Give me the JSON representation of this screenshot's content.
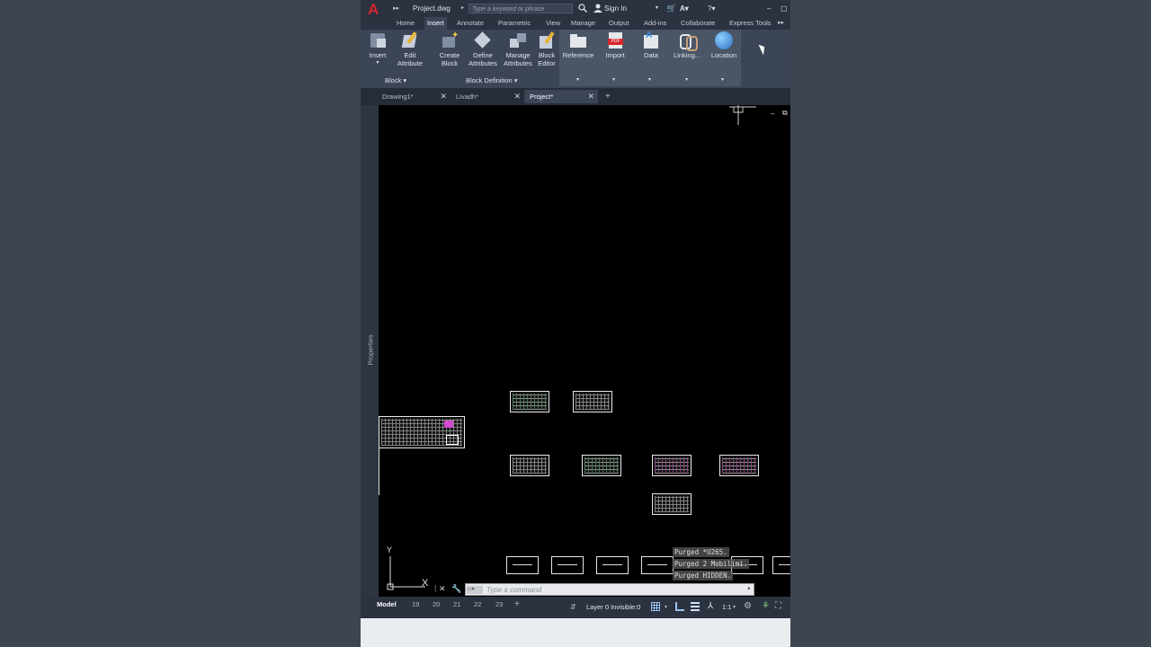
{
  "titlebar": {
    "file_name": "Project.dwg",
    "search_placeholder": "Type a keyword or phrase",
    "sign_in": "Sign In"
  },
  "ribbon_tabs": [
    "Home",
    "Insert",
    "Annotate",
    "Parametric",
    "View",
    "Manage",
    "Output",
    "Add-ins",
    "Collaborate",
    "Express Tools"
  ],
  "active_ribbon_tab": "Insert",
  "ribbon": {
    "insert": "Insert",
    "edit_attribute_1": "Edit",
    "edit_attribute_2": "Attribute",
    "create_block_1": "Create",
    "create_block_2": "Block",
    "define_attributes_1": "Define",
    "define_attributes_2": "Attributes",
    "manage_attributes_1": "Manage",
    "manage_attributes_2": "Attributes",
    "block_editor_1": "Block",
    "block_editor_2": "Editor",
    "reference": "Reference",
    "import": "Import",
    "data": "Data",
    "linking": "Linking...",
    "location": "Location",
    "panel_block": "Block",
    "panel_block_definition": "Block Definition"
  },
  "doc_tabs": [
    "Drawing1*",
    "Livadh*",
    "Project*"
  ],
  "active_doc_tab": "Project*",
  "properties_label": "Properties",
  "command_history": [
    "Purged *U265.",
    "Purged 2 Mobilimi.",
    "Purged HIDDEN."
  ],
  "command_placeholder": "Type a command",
  "status": {
    "layout_tabs": [
      "Model",
      "19",
      "20",
      "21",
      "22",
      "23"
    ],
    "active_layout": "Model",
    "layer_text": "Layer 0 Invisible:0",
    "scale": "1:1"
  },
  "ucs": {
    "y_label": "Y",
    "x_label": "X"
  },
  "colors": {
    "accent": "#d8262c",
    "ribbon_bg": "#3b4556",
    "canvas": "#000000"
  }
}
